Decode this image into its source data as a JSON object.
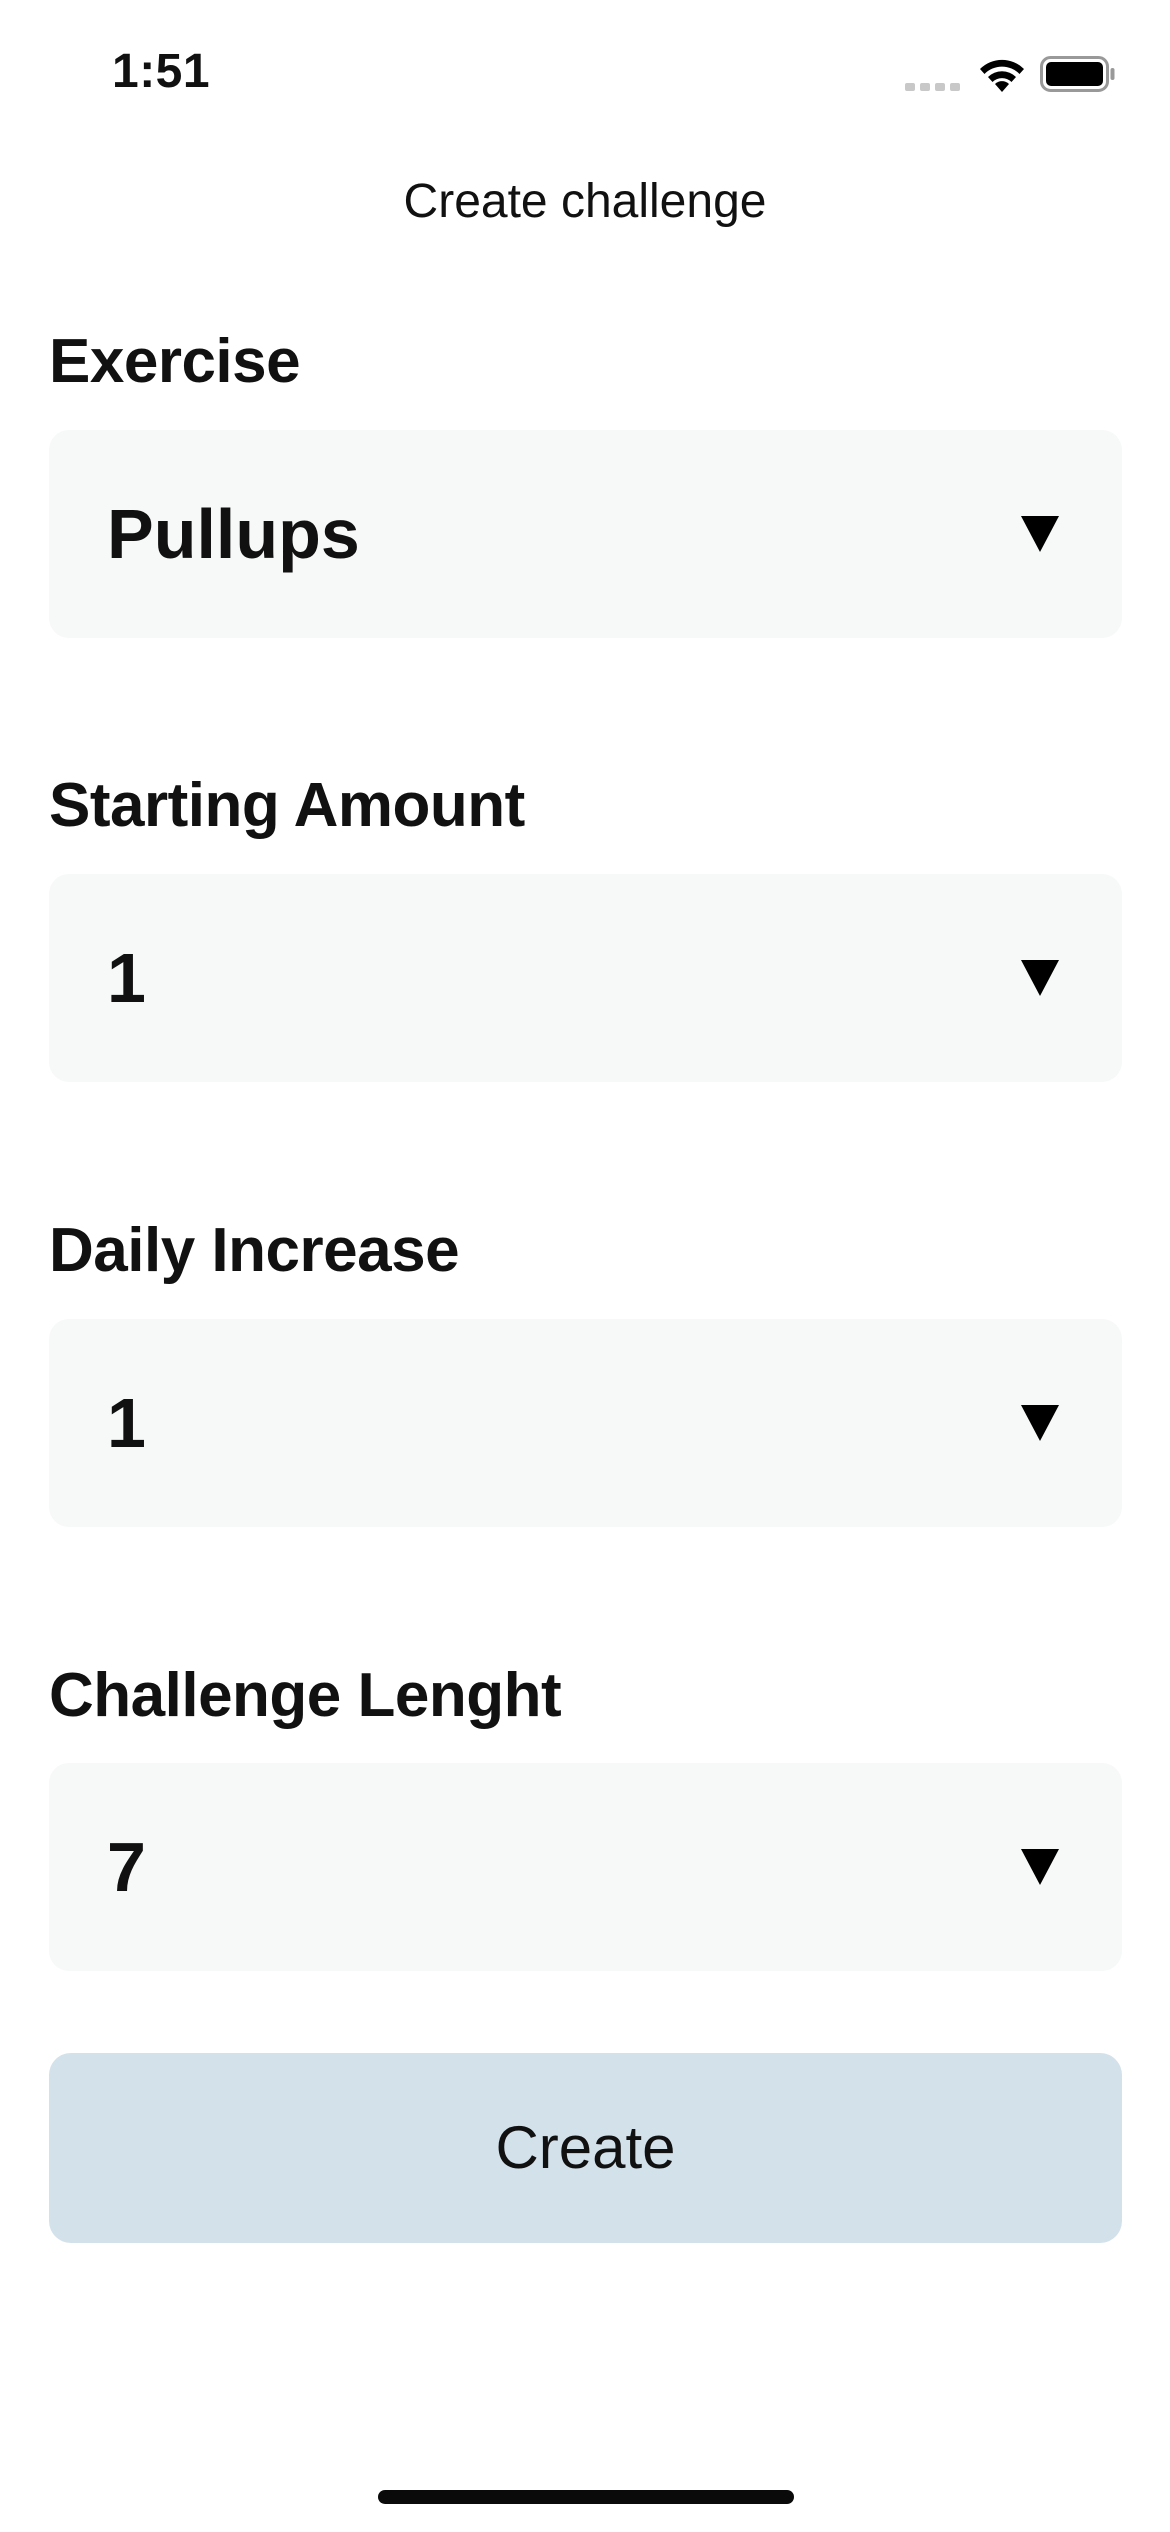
{
  "status_bar": {
    "time": "1:51",
    "icons": [
      "cellular-signal-icon",
      "wifi-icon",
      "battery-icon"
    ]
  },
  "header": {
    "title": "Create challenge"
  },
  "form": {
    "fields": [
      {
        "label": "Exercise",
        "value": "Pullups",
        "icon": "chevron-down-icon"
      },
      {
        "label": "Starting Amount",
        "value": "1",
        "icon": "chevron-down-icon"
      },
      {
        "label": "Daily Increase",
        "value": "1",
        "icon": "chevron-down-icon"
      },
      {
        "label": "Challenge Lenght",
        "value": "7",
        "icon": "chevron-down-icon"
      }
    ],
    "create_label": "Create"
  },
  "colors": {
    "select_background": "#f7f8f8",
    "button_background": "#d3e1ea",
    "text": "#111111"
  }
}
